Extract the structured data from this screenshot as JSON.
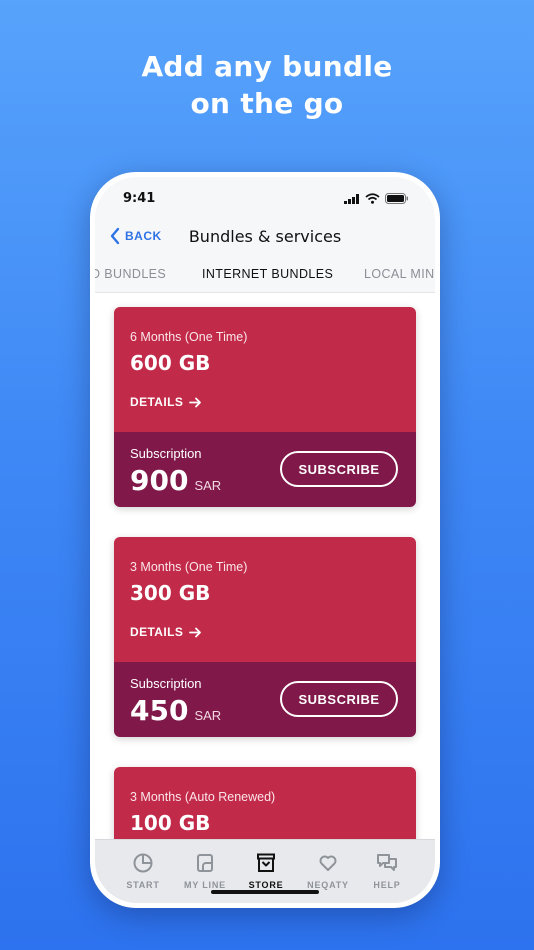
{
  "headline": {
    "line1": "Add any bundle",
    "line2": "on the go"
  },
  "status": {
    "time": "9:41"
  },
  "nav": {
    "back_label": "BACK",
    "title": "Bundles & services"
  },
  "tabs": [
    {
      "label": "D BUNDLES"
    },
    {
      "label": "INTERNET BUNDLES",
      "active": true
    },
    {
      "label": "LOCAL MIN"
    }
  ],
  "bundles": [
    {
      "period": "6 Months (One Time)",
      "volume": "600 GB",
      "details_label": "DETAILS",
      "subscription_label": "Subscription",
      "price": "900",
      "currency": "SAR",
      "subscribe_label": "SUBSCRIBE"
    },
    {
      "period": "3 Months (One Time)",
      "volume": "300 GB",
      "details_label": "DETAILS",
      "subscription_label": "Subscription",
      "price": "450",
      "currency": "SAR",
      "subscribe_label": "SUBSCRIBE"
    },
    {
      "period": "3 Months (Auto Renewed)",
      "volume": "100 GB"
    }
  ],
  "tabbar": [
    {
      "label": "START",
      "icon": "pie-chart-icon"
    },
    {
      "label": "MY LINE",
      "icon": "sim-card-icon"
    },
    {
      "label": "STORE",
      "icon": "store-icon",
      "active": true
    },
    {
      "label": "NEQATY",
      "icon": "heart-icon"
    },
    {
      "label": "HELP",
      "icon": "chat-bubbles-icon"
    }
  ],
  "colors": {
    "card_top": "#c12a49",
    "card_bottom": "#80184a",
    "accent": "#2f73e6",
    "background": "#3f89f6"
  }
}
